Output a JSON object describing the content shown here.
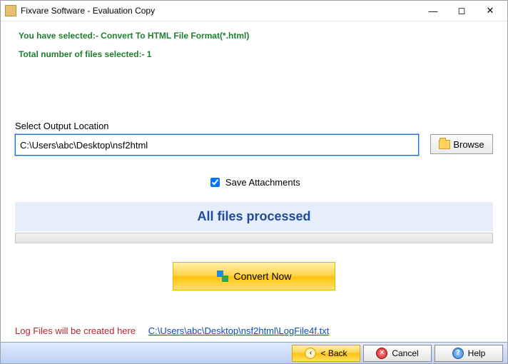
{
  "window": {
    "title": "Fixvare Software - Evaluation Copy"
  },
  "info": {
    "selected_format": "You have selected:- Convert To HTML File Format(*.html)",
    "file_count": "Total number of files selected:- 1"
  },
  "output": {
    "label": "Select Output Location",
    "path": "C:\\Users\\abc\\Desktop\\nsf2html",
    "browse": "Browse"
  },
  "options": {
    "save_attachments_label": "Save Attachments",
    "save_attachments_checked": true
  },
  "status": {
    "message": "All files processed"
  },
  "actions": {
    "convert": "Convert Now"
  },
  "log": {
    "label": "Log Files will be created here",
    "path": "C:\\Users\\abc\\Desktop\\nsf2html\\LogFile4f.txt"
  },
  "footer": {
    "back": "< Back",
    "cancel": "Cancel",
    "help": "Help"
  }
}
